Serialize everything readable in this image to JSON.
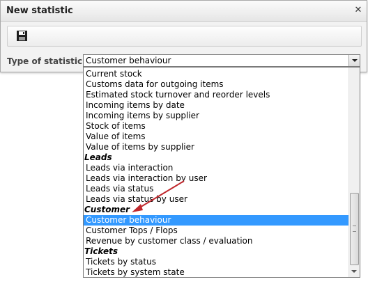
{
  "dialog": {
    "title": "New statistic",
    "close_icon": "close-icon",
    "toolbar": {
      "save_icon": "floppy-disk-icon"
    }
  },
  "form": {
    "type_label": "Type of statistic",
    "selected_value": "Customer behaviour"
  },
  "dropdown": {
    "items": [
      {
        "kind": "option",
        "label": "Current stock"
      },
      {
        "kind": "option",
        "label": "Customs data for outgoing items"
      },
      {
        "kind": "option",
        "label": "Estimated stock turnover and reorder levels"
      },
      {
        "kind": "option",
        "label": "Incoming items by date"
      },
      {
        "kind": "option",
        "label": "Incoming items by supplier"
      },
      {
        "kind": "option",
        "label": "Stock of items"
      },
      {
        "kind": "option",
        "label": "Value of items"
      },
      {
        "kind": "option",
        "label": "Value of items by supplier"
      },
      {
        "kind": "group",
        "label": "Leads"
      },
      {
        "kind": "option",
        "label": "Leads via interaction"
      },
      {
        "kind": "option",
        "label": "Leads via interaction by user"
      },
      {
        "kind": "option",
        "label": "Leads via status"
      },
      {
        "kind": "option",
        "label": "Leads via status by user"
      },
      {
        "kind": "group",
        "label": "Customer"
      },
      {
        "kind": "option",
        "label": "Customer behaviour",
        "selected": true
      },
      {
        "kind": "option",
        "label": "Customer Tops / Flops"
      },
      {
        "kind": "option",
        "label": "Revenue by customer class / evaluation"
      },
      {
        "kind": "group",
        "label": "Tickets"
      },
      {
        "kind": "option",
        "label": "Tickets by status"
      },
      {
        "kind": "option",
        "label": "Tickets by system state"
      }
    ]
  },
  "colors": {
    "highlight": "#3399ff",
    "annotation_arrow": "#c0282d"
  }
}
